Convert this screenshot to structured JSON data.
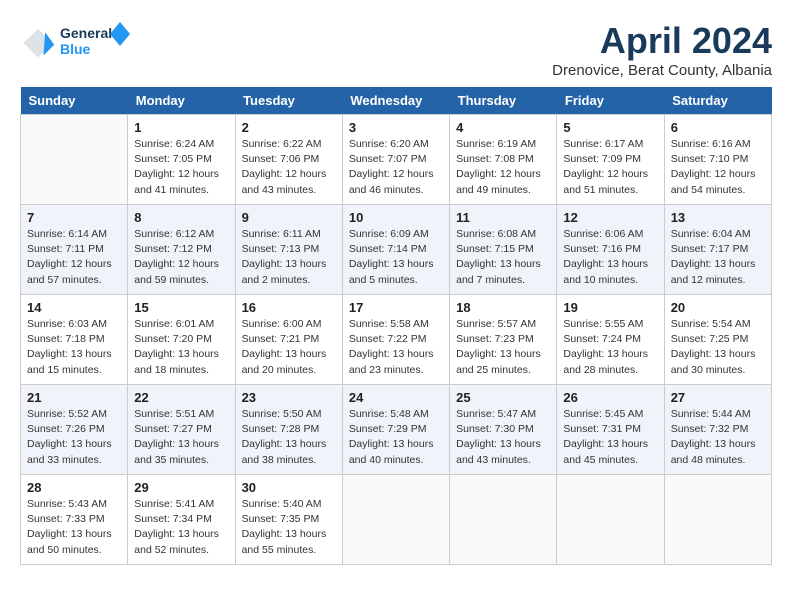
{
  "header": {
    "logo_line1": "General",
    "logo_line2": "Blue",
    "month": "April 2024",
    "location": "Drenovice, Berat County, Albania"
  },
  "weekdays": [
    "Sunday",
    "Monday",
    "Tuesday",
    "Wednesday",
    "Thursday",
    "Friday",
    "Saturday"
  ],
  "weeks": [
    [
      {
        "day": "",
        "info": ""
      },
      {
        "day": "1",
        "info": "Sunrise: 6:24 AM\nSunset: 7:05 PM\nDaylight: 12 hours\nand 41 minutes."
      },
      {
        "day": "2",
        "info": "Sunrise: 6:22 AM\nSunset: 7:06 PM\nDaylight: 12 hours\nand 43 minutes."
      },
      {
        "day": "3",
        "info": "Sunrise: 6:20 AM\nSunset: 7:07 PM\nDaylight: 12 hours\nand 46 minutes."
      },
      {
        "day": "4",
        "info": "Sunrise: 6:19 AM\nSunset: 7:08 PM\nDaylight: 12 hours\nand 49 minutes."
      },
      {
        "day": "5",
        "info": "Sunrise: 6:17 AM\nSunset: 7:09 PM\nDaylight: 12 hours\nand 51 minutes."
      },
      {
        "day": "6",
        "info": "Sunrise: 6:16 AM\nSunset: 7:10 PM\nDaylight: 12 hours\nand 54 minutes."
      }
    ],
    [
      {
        "day": "7",
        "info": "Sunrise: 6:14 AM\nSunset: 7:11 PM\nDaylight: 12 hours\nand 57 minutes."
      },
      {
        "day": "8",
        "info": "Sunrise: 6:12 AM\nSunset: 7:12 PM\nDaylight: 12 hours\nand 59 minutes."
      },
      {
        "day": "9",
        "info": "Sunrise: 6:11 AM\nSunset: 7:13 PM\nDaylight: 13 hours\nand 2 minutes."
      },
      {
        "day": "10",
        "info": "Sunrise: 6:09 AM\nSunset: 7:14 PM\nDaylight: 13 hours\nand 5 minutes."
      },
      {
        "day": "11",
        "info": "Sunrise: 6:08 AM\nSunset: 7:15 PM\nDaylight: 13 hours\nand 7 minutes."
      },
      {
        "day": "12",
        "info": "Sunrise: 6:06 AM\nSunset: 7:16 PM\nDaylight: 13 hours\nand 10 minutes."
      },
      {
        "day": "13",
        "info": "Sunrise: 6:04 AM\nSunset: 7:17 PM\nDaylight: 13 hours\nand 12 minutes."
      }
    ],
    [
      {
        "day": "14",
        "info": "Sunrise: 6:03 AM\nSunset: 7:18 PM\nDaylight: 13 hours\nand 15 minutes."
      },
      {
        "day": "15",
        "info": "Sunrise: 6:01 AM\nSunset: 7:20 PM\nDaylight: 13 hours\nand 18 minutes."
      },
      {
        "day": "16",
        "info": "Sunrise: 6:00 AM\nSunset: 7:21 PM\nDaylight: 13 hours\nand 20 minutes."
      },
      {
        "day": "17",
        "info": "Sunrise: 5:58 AM\nSunset: 7:22 PM\nDaylight: 13 hours\nand 23 minutes."
      },
      {
        "day": "18",
        "info": "Sunrise: 5:57 AM\nSunset: 7:23 PM\nDaylight: 13 hours\nand 25 minutes."
      },
      {
        "day": "19",
        "info": "Sunrise: 5:55 AM\nSunset: 7:24 PM\nDaylight: 13 hours\nand 28 minutes."
      },
      {
        "day": "20",
        "info": "Sunrise: 5:54 AM\nSunset: 7:25 PM\nDaylight: 13 hours\nand 30 minutes."
      }
    ],
    [
      {
        "day": "21",
        "info": "Sunrise: 5:52 AM\nSunset: 7:26 PM\nDaylight: 13 hours\nand 33 minutes."
      },
      {
        "day": "22",
        "info": "Sunrise: 5:51 AM\nSunset: 7:27 PM\nDaylight: 13 hours\nand 35 minutes."
      },
      {
        "day": "23",
        "info": "Sunrise: 5:50 AM\nSunset: 7:28 PM\nDaylight: 13 hours\nand 38 minutes."
      },
      {
        "day": "24",
        "info": "Sunrise: 5:48 AM\nSunset: 7:29 PM\nDaylight: 13 hours\nand 40 minutes."
      },
      {
        "day": "25",
        "info": "Sunrise: 5:47 AM\nSunset: 7:30 PM\nDaylight: 13 hours\nand 43 minutes."
      },
      {
        "day": "26",
        "info": "Sunrise: 5:45 AM\nSunset: 7:31 PM\nDaylight: 13 hours\nand 45 minutes."
      },
      {
        "day": "27",
        "info": "Sunrise: 5:44 AM\nSunset: 7:32 PM\nDaylight: 13 hours\nand 48 minutes."
      }
    ],
    [
      {
        "day": "28",
        "info": "Sunrise: 5:43 AM\nSunset: 7:33 PM\nDaylight: 13 hours\nand 50 minutes."
      },
      {
        "day": "29",
        "info": "Sunrise: 5:41 AM\nSunset: 7:34 PM\nDaylight: 13 hours\nand 52 minutes."
      },
      {
        "day": "30",
        "info": "Sunrise: 5:40 AM\nSunset: 7:35 PM\nDaylight: 13 hours\nand 55 minutes."
      },
      {
        "day": "",
        "info": ""
      },
      {
        "day": "",
        "info": ""
      },
      {
        "day": "",
        "info": ""
      },
      {
        "day": "",
        "info": ""
      }
    ]
  ]
}
